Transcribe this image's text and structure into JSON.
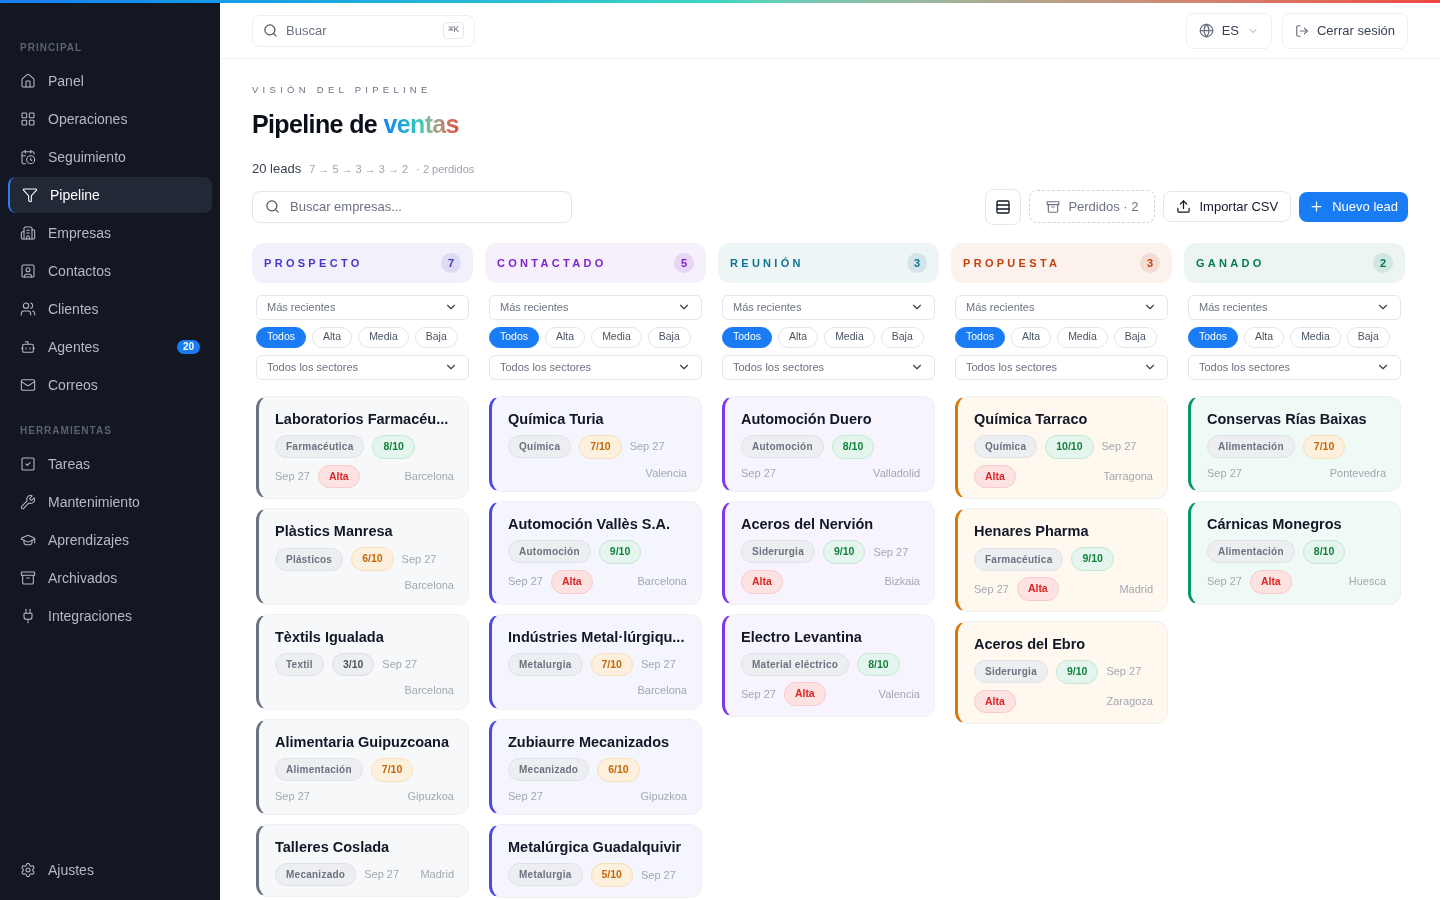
{
  "sidebar": {
    "sections": [
      {
        "title": "PRINCIPAL",
        "items": [
          {
            "label": "Panel",
            "selected": false
          },
          {
            "label": "Operaciones",
            "selected": false
          },
          {
            "label": "Seguimiento",
            "selected": false
          },
          {
            "label": "Pipeline",
            "selected": true
          },
          {
            "label": "Empresas",
            "selected": false
          },
          {
            "label": "Contactos",
            "selected": false
          },
          {
            "label": "Clientes",
            "selected": false
          },
          {
            "label": "Agentes",
            "selected": false,
            "badge": "20"
          },
          {
            "label": "Correos",
            "selected": false
          }
        ]
      },
      {
        "title": "HERRAMIENTAS",
        "items": [
          {
            "label": "Tareas",
            "selected": false
          },
          {
            "label": "Mantenimiento",
            "selected": false
          },
          {
            "label": "Aprendizajes",
            "selected": false
          },
          {
            "label": "Archivados",
            "selected": false
          },
          {
            "label": "Integraciones",
            "selected": false
          }
        ]
      }
    ],
    "footer": {
      "label": "Ajustes",
      "selected": false
    }
  },
  "topbar": {
    "search": {
      "placeholder": "Buscar",
      "shortcut": "⌘K"
    },
    "language": "ES",
    "logout": "Cerrar sesión"
  },
  "header": {
    "eyebrow": "VISIÓN DEL PIPELINE",
    "title": "Pipeline de",
    "title_accent": "ventas",
    "leads": "20 leads",
    "funnel": "7 → 5 → 3 → 3 → 2",
    "lost": "· 2 perdidos"
  },
  "toolbar": {
    "search": {
      "placeholder": "Buscar empresas..."
    },
    "lost_button": "Perdidos · 2",
    "import_button": "Importar CSV",
    "new_button": "Nuevo lead"
  },
  "columns": [
    {
      "title": "PROSPECTO",
      "count": "7",
      "color": "#4338ca",
      "kind": "prospect",
      "sort": "Más recientes",
      "sector": "Todos los sectores",
      "filters": [
        {
          "label": "Todos",
          "selected": true
        },
        {
          "label": "Alta",
          "selected": false
        },
        {
          "label": "Media",
          "selected": false
        },
        {
          "label": "Baja",
          "selected": false
        }
      ],
      "cards": [
        {
          "name": "Laboratorios Farmacéu...",
          "tags": [
            {
              "kind": "sector",
              "text": "Farmacéutica"
            },
            {
              "kind": "score_high",
              "text": "8/10"
            }
          ],
          "meta": [
            {
              "kind": "date",
              "text": "Sep 27"
            },
            {
              "kind": "priority",
              "text": "Alta"
            },
            {
              "kind": "city",
              "text": "Barcelona"
            }
          ]
        },
        {
          "name": "Plàstics Manresa",
          "tags": [
            {
              "kind": "sector",
              "text": "Plásticos"
            },
            {
              "kind": "score_mid",
              "text": "6/10"
            },
            {
              "kind": "date",
              "text": "Sep 27"
            }
          ],
          "meta": [
            {
              "kind": "city",
              "text": "Barcelona"
            }
          ]
        },
        {
          "name": "Tèxtils Igualada",
          "tags": [
            {
              "kind": "sector",
              "text": "Textil"
            },
            {
              "kind": "score_low",
              "text": "3/10"
            },
            {
              "kind": "date",
              "text": "Sep 27"
            }
          ],
          "meta": [
            {
              "kind": "city",
              "text": "Barcelona"
            }
          ]
        },
        {
          "name": "Alimentaria Guipuzcoana",
          "tags": [
            {
              "kind": "sector",
              "text": "Alimentación"
            },
            {
              "kind": "score_mid",
              "text": "7/10"
            }
          ],
          "meta": [
            {
              "kind": "date",
              "text": "Sep 27"
            },
            {
              "kind": "city",
              "text": "Gipuzkoa"
            }
          ]
        },
        {
          "name": "Talleres Coslada",
          "tags": [
            {
              "kind": "sector",
              "text": "Mecanizado"
            },
            {
              "kind": "date",
              "text": "Sep 27"
            },
            {
              "kind": "city",
              "text": "Madrid"
            }
          ]
        }
      ]
    },
    {
      "title": "CONTACTADO",
      "count": "5",
      "color": "#7e22ce",
      "kind": "contacted",
      "sort": "Más recientes",
      "sector": "Todos los sectores",
      "filters": [
        {
          "label": "Todos",
          "selected": true
        },
        {
          "label": "Alta",
          "selected": false
        },
        {
          "label": "Media",
          "selected": false
        },
        {
          "label": "Baja",
          "selected": false
        }
      ],
      "cards": [
        {
          "name": "Química Turia",
          "tags": [
            {
              "kind": "sector",
              "text": "Química"
            },
            {
              "kind": "score_mid",
              "text": "7/10"
            },
            {
              "kind": "date",
              "text": "Sep 27"
            }
          ],
          "meta": [
            {
              "kind": "city",
              "text": "Valencia"
            }
          ]
        },
        {
          "name": "Automoción Vallès S.A.",
          "tags": [
            {
              "kind": "sector",
              "text": "Automoción"
            },
            {
              "kind": "score_high",
              "text": "9/10"
            }
          ],
          "meta": [
            {
              "kind": "date",
              "text": "Sep 27"
            },
            {
              "kind": "priority",
              "text": "Alta"
            },
            {
              "kind": "city",
              "text": "Barcelona"
            }
          ]
        },
        {
          "name": "Indústries Metal·lúrgiqu...",
          "tags": [
            {
              "kind": "sector",
              "text": "Metalurgia"
            },
            {
              "kind": "score_mid",
              "text": "7/10"
            },
            {
              "kind": "date",
              "text": "Sep 27"
            }
          ],
          "meta": [
            {
              "kind": "city",
              "text": "Barcelona"
            }
          ]
        },
        {
          "name": "Zubiaurre Mecanizados",
          "tags": [
            {
              "kind": "sector",
              "text": "Mecanizado"
            },
            {
              "kind": "score_mid",
              "text": "6/10"
            }
          ],
          "meta": [
            {
              "kind": "date",
              "text": "Sep 27"
            },
            {
              "kind": "city",
              "text": "Gipuzkoa"
            }
          ]
        },
        {
          "name": "Metalúrgica Guadalquivir",
          "tags": [
            {
              "kind": "sector",
              "text": "Metalurgia"
            },
            {
              "kind": "score_mid",
              "text": "5/10"
            },
            {
              "kind": "date",
              "text": "Sep 27"
            }
          ]
        }
      ]
    },
    {
      "title": "REUNIÓN",
      "count": "3",
      "color": "#0e7490",
      "kind": "meeting",
      "sort": "Más recientes",
      "sector": "Todos los sectores",
      "filters": [
        {
          "label": "Todos",
          "selected": true
        },
        {
          "label": "Alta",
          "selected": false
        },
        {
          "label": "Media",
          "selected": false
        },
        {
          "label": "Baja",
          "selected": false
        }
      ],
      "cards": [
        {
          "name": "Automoción Duero",
          "tags": [
            {
              "kind": "sector",
              "text": "Automoción"
            },
            {
              "kind": "score_high",
              "text": "8/10"
            }
          ],
          "meta": [
            {
              "kind": "date",
              "text": "Sep 27"
            },
            {
              "kind": "city",
              "text": "Valladolid"
            }
          ]
        },
        {
          "name": "Aceros del Nervión",
          "tags": [
            {
              "kind": "sector",
              "text": "Siderurgia"
            },
            {
              "kind": "score_high",
              "text": "9/10"
            },
            {
              "kind": "date",
              "text": "Sep 27"
            }
          ],
          "meta": [
            {
              "kind": "priority",
              "text": "Alta"
            },
            {
              "kind": "city",
              "text": "Bizkaia"
            }
          ]
        },
        {
          "name": "Electro Levantina",
          "tags": [
            {
              "kind": "sector",
              "text": "Material eléctrico"
            },
            {
              "kind": "score_high",
              "text": "8/10"
            }
          ],
          "meta": [
            {
              "kind": "date",
              "text": "Sep 27"
            },
            {
              "kind": "priority",
              "text": "Alta"
            },
            {
              "kind": "city",
              "text": "Valencia"
            }
          ]
        }
      ]
    },
    {
      "title": "PROPUESTA",
      "count": "3",
      "color": "#c2410c",
      "kind": "proposal",
      "sort": "Más recientes",
      "sector": "Todos los sectores",
      "filters": [
        {
          "label": "Todos",
          "selected": true
        },
        {
          "label": "Alta",
          "selected": false
        },
        {
          "label": "Media",
          "selected": false
        },
        {
          "label": "Baja",
          "selected": false
        }
      ],
      "cards": [
        {
          "name": "Química Tarraco",
          "tags": [
            {
              "kind": "sector",
              "text": "Química"
            },
            {
              "kind": "score_high",
              "text": "10/10"
            },
            {
              "kind": "date",
              "text": "Sep 27"
            }
          ],
          "meta": [
            {
              "kind": "priority",
              "text": "Alta"
            },
            {
              "kind": "city",
              "text": "Tarragona"
            }
          ]
        },
        {
          "name": "Henares Pharma",
          "tags": [
            {
              "kind": "sector",
              "text": "Farmacéutica"
            },
            {
              "kind": "score_high",
              "text": "9/10"
            }
          ],
          "meta": [
            {
              "kind": "date",
              "text": "Sep 27"
            },
            {
              "kind": "priority",
              "text": "Alta"
            },
            {
              "kind": "city",
              "text": "Madrid"
            }
          ]
        },
        {
          "name": "Aceros del Ebro",
          "tags": [
            {
              "kind": "sector",
              "text": "Siderurgia"
            },
            {
              "kind": "score_high",
              "text": "9/10"
            },
            {
              "kind": "date",
              "text": "Sep 27"
            }
          ],
          "meta": [
            {
              "kind": "priority",
              "text": "Alta"
            },
            {
              "kind": "city",
              "text": "Zaragoza"
            }
          ]
        }
      ]
    },
    {
      "title": "GANADO",
      "count": "2",
      "color": "#047857",
      "kind": "won",
      "sort": "Más recientes",
      "sector": "Todos los sectores",
      "filters": [
        {
          "label": "Todos",
          "selected": true
        },
        {
          "label": "Alta",
          "selected": false
        },
        {
          "label": "Media",
          "selected": false
        },
        {
          "label": "Baja",
          "selected": false
        }
      ],
      "cards": [
        {
          "name": "Conservas Rías Baixas",
          "tags": [
            {
              "kind": "sector",
              "text": "Alimentación"
            },
            {
              "kind": "score_mid",
              "text": "7/10"
            }
          ],
          "meta": [
            {
              "kind": "date",
              "text": "Sep 27"
            },
            {
              "kind": "city",
              "text": "Pontevedra"
            }
          ]
        },
        {
          "name": "Cárnicas Monegros",
          "tags": [
            {
              "kind": "sector",
              "text": "Alimentación"
            },
            {
              "kind": "score_high",
              "text": "8/10"
            }
          ],
          "meta": [
            {
              "kind": "date",
              "text": "Sep 27"
            },
            {
              "kind": "priority",
              "text": "Alta"
            },
            {
              "kind": "city",
              "text": "Huesca"
            }
          ]
        }
      ]
    }
  ]
}
